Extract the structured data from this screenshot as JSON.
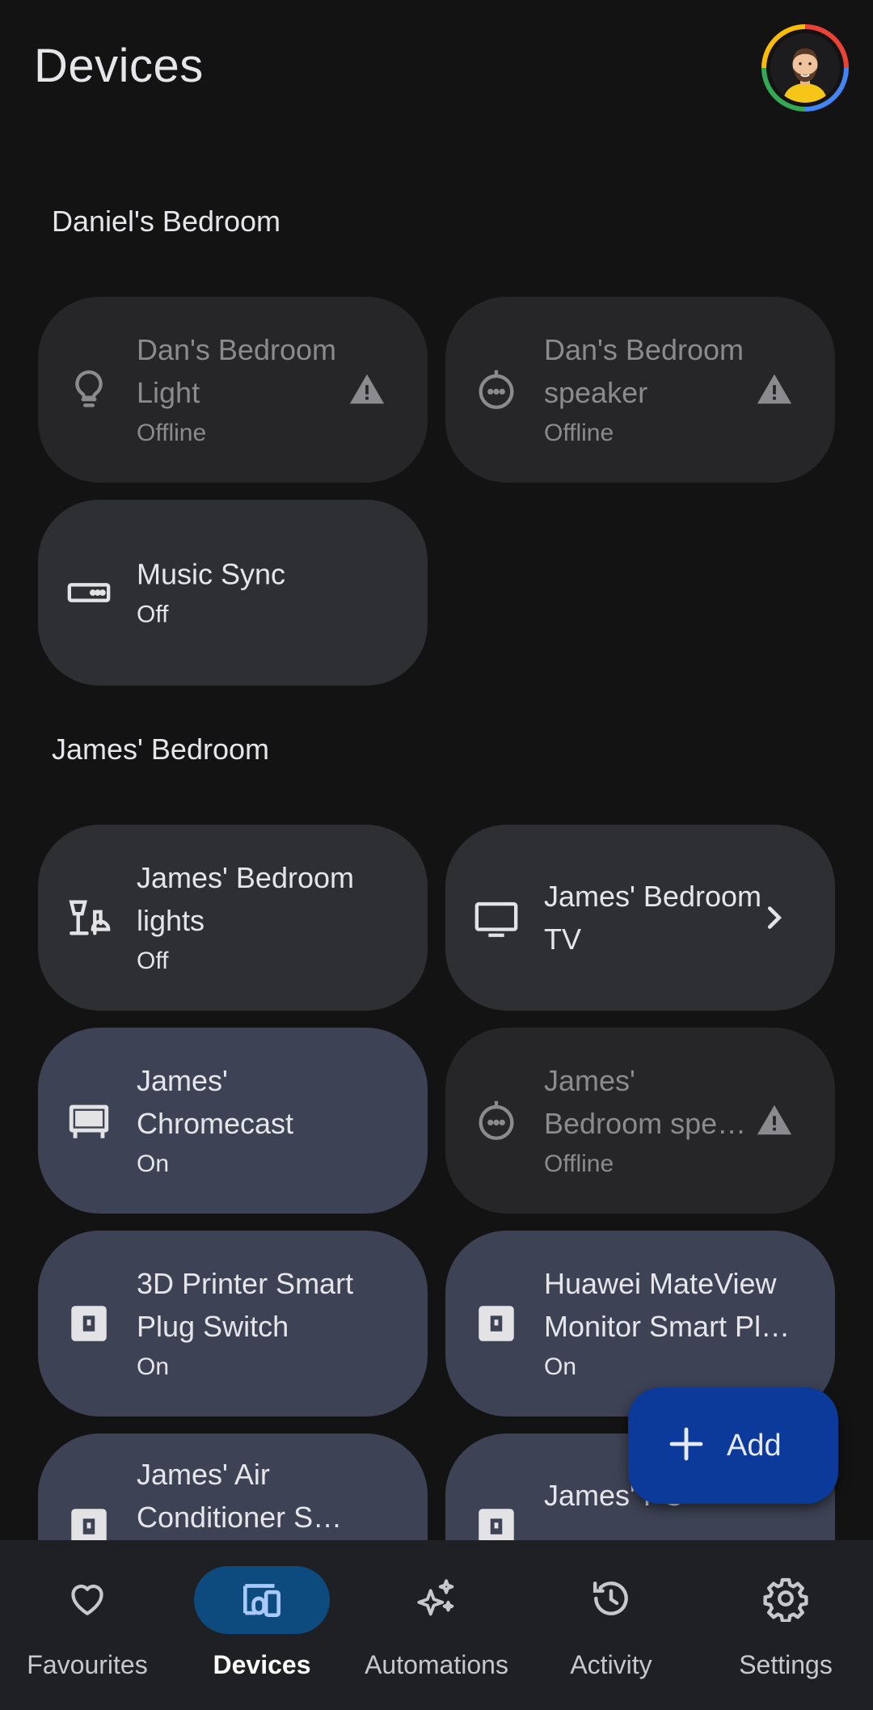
{
  "header": {
    "title": "Devices"
  },
  "sections": [
    {
      "title": "Daniel's Bedroom"
    },
    {
      "title": "James' Bedroom"
    }
  ],
  "tiles": [
    {
      "name": "Dan's Bedroom Light",
      "status": "Offline",
      "icon": "lightbulb-icon",
      "state": "offline"
    },
    {
      "name": "Dan's Bedroom speaker",
      "status": "Offline",
      "icon": "speaker-icon",
      "state": "offline"
    },
    {
      "name": "Music Sync",
      "status": "Off",
      "icon": "speaker-group-icon",
      "state": "off"
    },
    {
      "name": "James' Bedroom lights",
      "status": "Off",
      "icon": "lamps-icon",
      "state": "off"
    },
    {
      "name": "James' Bedroom TV",
      "status": "",
      "icon": "tv-icon",
      "state": "off"
    },
    {
      "name": "James' Chromecast",
      "status": "On",
      "icon": "chromecast-icon",
      "state": "on"
    },
    {
      "name_line1": "James'",
      "name_line2": "Bedroom spe…",
      "status": "Offline",
      "icon": "speaker-icon",
      "state": "offline"
    },
    {
      "name": "3D Printer Smart Plug Switch",
      "status": "On",
      "icon": "outlet-icon",
      "state": "on"
    },
    {
      "name_line1": "Huawei MateView",
      "name_line2": "Monitor Smart Pl…",
      "status": "On",
      "icon": "outlet-icon",
      "state": "on"
    },
    {
      "name_line1": "James' Air",
      "name_line2": "Conditioner Sma…",
      "status": "",
      "icon": "outlet-icon",
      "state": "on"
    },
    {
      "name": "James' PC",
      "status": "",
      "icon": "outlet-icon",
      "state": "on"
    }
  ],
  "fab": {
    "label": "Add",
    "icon": "plus-icon"
  },
  "nav": [
    {
      "label": "Favourites",
      "icon": "heart-icon",
      "active": false
    },
    {
      "label": "Devices",
      "icon": "devices-icon",
      "active": true
    },
    {
      "label": "Automations",
      "icon": "sparkle-icon",
      "active": false
    },
    {
      "label": "Activity",
      "icon": "history-icon",
      "active": false
    },
    {
      "label": "Settings",
      "icon": "gear-icon",
      "active": false
    }
  ],
  "colors": {
    "background": "#131314",
    "tile_off": "#2e2f33",
    "tile_offline": "#262628",
    "tile_on": "#3d4254",
    "fab": "#0b3a9a",
    "nav_active_pill": "#0d4a7e"
  }
}
